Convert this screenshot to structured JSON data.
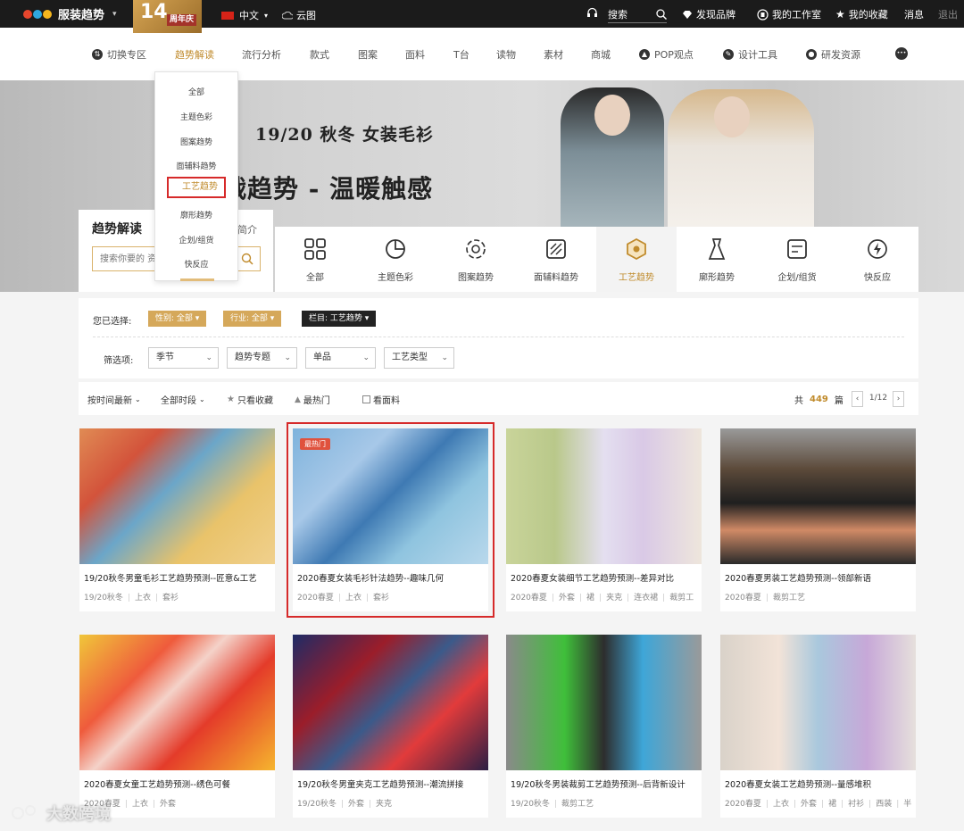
{
  "topbar": {
    "brand": "服装趋势",
    "brand_caret": "▾",
    "anniversary_num": "14",
    "anniversary_text": "周年庆",
    "language": "中文",
    "language_caret": "▾",
    "cloud": "云图",
    "search": "搜索",
    "discover_brand": "发现品牌",
    "my_studio": "我的工作室",
    "my_favorites": "我的收藏",
    "messages": "消息",
    "logout": "退出"
  },
  "nav": {
    "items": [
      "切换专区",
      "趋势解读",
      "流行分析",
      "款式",
      "图案",
      "面料",
      "T台",
      "读物",
      "素材",
      "商城",
      "POP观点",
      "设计工具",
      "研发资源"
    ],
    "more": "•••"
  },
  "dropdown": {
    "items": [
      "全部",
      "主题色彩",
      "图案趋势",
      "面辅料趋势",
      "工艺趋势",
      "廓形趋势",
      "企划/组货",
      "快反应"
    ]
  },
  "hero": {
    "title": "19/20 秋冬  女装毛衫",
    "subtitle": "战趋势 - 温暖触感"
  },
  "panel": {
    "title": "趋势解读",
    "search_placeholder": "搜索你要的 资",
    "intro": "简介"
  },
  "categories": [
    "全部",
    "主题色彩",
    "图案趋势",
    "面辅料趋势",
    "工艺趋势",
    "廓形趋势",
    "企划/组货",
    "快反应"
  ],
  "filters": {
    "selected_label": "您已选择:",
    "tags": [
      "性别: 全部",
      "行业: 全部",
      "栏目: 工艺趋势"
    ],
    "options_label": "筛选项:",
    "selects": [
      "季节",
      "趋势专题",
      "单品",
      "工艺类型"
    ]
  },
  "sortbar": {
    "by_time": "按时间最新",
    "all_time": "全部时段",
    "fav_only": "只看收藏",
    "hottest": "最热门",
    "by_fabric": "看面料",
    "total_prefix": "共",
    "total": "449",
    "total_suffix": "篇",
    "page": "1/12",
    "prev": "‹",
    "next": "›"
  },
  "cards": [
    {
      "title": "19/20秋冬男童毛衫工艺趋势预测--匠意&工艺",
      "tags": [
        "19/20秋冬",
        "上衣",
        "套衫"
      ],
      "hot": ""
    },
    {
      "title": "2020春夏女装毛衫针法趋势--趣味几何",
      "tags": [
        "2020春夏",
        "上衣",
        "套衫"
      ],
      "hot": "最热门"
    },
    {
      "title": "2020春夏女装细节工艺趋势预测--差异对比",
      "tags": [
        "2020春夏",
        "外套",
        "裙",
        "夹克",
        "连衣裙",
        "裁剪工"
      ],
      "hot": ""
    },
    {
      "title": "2020春夏男装工艺趋势预测--领部新语",
      "tags": [
        "2020春夏",
        "裁剪工艺"
      ],
      "hot": ""
    },
    {
      "title": "2020春夏女童工艺趋势预测--绣色可餐",
      "tags": [
        "2020春夏",
        "上衣",
        "外套"
      ],
      "hot": ""
    },
    {
      "title": "19/20秋冬男童夹克工艺趋势预测--潮流拼接",
      "tags": [
        "19/20秋冬",
        "外套",
        "夹克"
      ],
      "hot": ""
    },
    {
      "title": "19/20秋冬男装裁剪工艺趋势预测--后背新设计",
      "tags": [
        "19/20秋冬",
        "裁剪工艺"
      ],
      "hot": ""
    },
    {
      "title": "2020春夏女装工艺趋势预测--量感堆积",
      "tags": [
        "2020春夏",
        "上衣",
        "外套",
        "裙",
        "衬衫",
        "西装",
        "半"
      ],
      "hot": ""
    }
  ],
  "watermark": "大数跨境",
  "colors": {
    "accent": "#c08b2c",
    "highlight": "#d62a2a",
    "topbar": "#1b1b1b"
  }
}
